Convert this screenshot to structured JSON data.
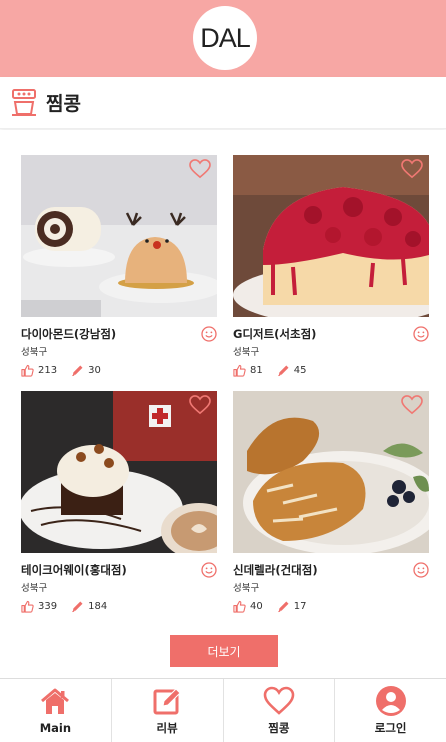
{
  "header": {
    "logo_text": "DAL"
  },
  "page": {
    "title": "찜콩"
  },
  "cards": [
    {
      "name": "다이아몬드(강남점)",
      "district": "성북구",
      "likes": "213",
      "reviews": "30"
    },
    {
      "name": "G디저트(서초점)",
      "district": "성북구",
      "likes": "81",
      "reviews": "45"
    },
    {
      "name": "테이크어웨이(홍대점)",
      "district": "성북구",
      "likes": "339",
      "reviews": "184"
    },
    {
      "name": "신데렐라(건대점)",
      "district": "성북구",
      "likes": "40",
      "reviews": "17"
    }
  ],
  "more_button": {
    "label": "더보기"
  },
  "nav": {
    "main": "Main",
    "review": "리뷰",
    "favorites": "찜콩",
    "login": "로그인"
  },
  "colors": {
    "header": "#f7a7a4",
    "accent": "#ef6f6a"
  },
  "icons": {
    "title": "store-counter-icon",
    "like": "thumbs-up-icon",
    "review": "pencil-icon",
    "favorite": "heart-icon",
    "smile": "smile-icon",
    "home": "home-icon",
    "edit": "edit-icon",
    "user": "user-icon"
  }
}
